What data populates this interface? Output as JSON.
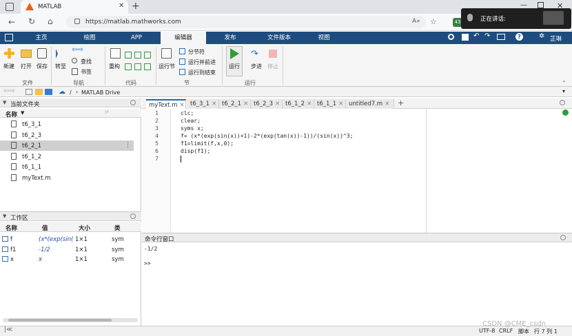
{
  "browser": {
    "tab_title": "MATLAB",
    "url": "https://matlab.mathworks.com",
    "zoom_badge": "43",
    "speaking_label": "正在讲话:"
  },
  "ribbon": {
    "tabs": [
      "主页",
      "绘图",
      "APP",
      "编辑器",
      "发布",
      "文件版本",
      "视图"
    ],
    "user": "芷琳",
    "file": {
      "new": "新建",
      "open": "打开",
      "save": "保存",
      "group": "文件"
    },
    "nav": {
      "goto": "转至",
      "find": "查找",
      "bookmark": "书签",
      "group": "导航"
    },
    "code": {
      "refactor": "重构",
      "group": "代码"
    },
    "section": {
      "run_section": "运行节",
      "section_break": "分节符",
      "run_advance": "运行并前进",
      "run_to_end": "运行到结束",
      "group": "节"
    },
    "run": {
      "run": "运行",
      "step": "步进",
      "stop": "停止",
      "group": "运行"
    }
  },
  "pathbar": {
    "sep": "/",
    "path": "MATLAB Drive"
  },
  "filebrowser": {
    "title": "当前文件夹",
    "col_name": "名称",
    "files": [
      "t6_3_1",
      "t6_2_3",
      "t6_2_1",
      "t6_1_2",
      "t6_1_1",
      "myText.m"
    ]
  },
  "workspace": {
    "title": "工作区",
    "cols": [
      "名称",
      "值",
      "大小",
      "类"
    ],
    "rows": [
      {
        "name": "f",
        "value": "(x*(exp(sin(...",
        "size": "1×1",
        "class": "sym"
      },
      {
        "name": "f1",
        "value": "-1/2",
        "size": "1×1",
        "class": "sym"
      },
      {
        "name": "x",
        "value": "x",
        "size": "1×1",
        "class": "sym"
      }
    ]
  },
  "editor": {
    "tabs": [
      "myText.m",
      "t6_3_1",
      "t6_2_1",
      "t6_2_3",
      "t6_1_2",
      "t6_1_1",
      "untitled7.m"
    ],
    "lines": [
      "clc;",
      "clear;",
      "syms x;",
      "f= (x*(exp(sin(x))+1)-2*(exp(tan(x))-1))/(sin(x))^3;",
      "f1=limit(f,x,0);",
      "disp(f1);",
      ""
    ],
    "line_numbers": [
      "1",
      "2",
      "3",
      "4",
      "5",
      "6",
      "7"
    ]
  },
  "command": {
    "title": "命令行窗口",
    "output": "-1/2",
    "prompt": ">>"
  },
  "status": {
    "encoding": "UTF-8",
    "eol": "CRLF",
    "type": "脚本",
    "position": "行 7 列 1"
  },
  "watermark": "CSDN @CME_csdn",
  "colors": {
    "ribbon_bar": "#1e4c7e",
    "accent": "#0e6fc1",
    "run_green": "#2e9e3a"
  }
}
